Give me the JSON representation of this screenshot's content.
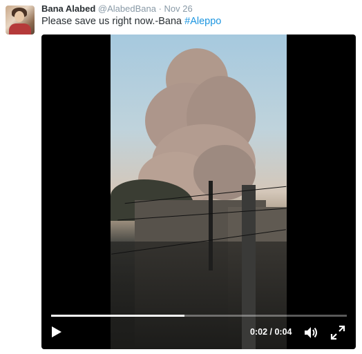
{
  "tweet": {
    "author_name": "Bana Alabed",
    "handle": "@AlabedBana",
    "separator": "·",
    "date": "Nov 26",
    "text": "Please save us right now.-Bana ",
    "hashtag": "#Aleppo"
  },
  "video": {
    "current_time": "0:02",
    "time_separator": " / ",
    "duration": "0:04",
    "progress_fraction": 0.45,
    "icons": {
      "play": "play-icon",
      "volume": "volume-icon",
      "fullscreen": "fullscreen-icon"
    }
  },
  "colors": {
    "hashtag": "#1b95e0",
    "meta": "#8899a6",
    "text": "#292f33"
  }
}
